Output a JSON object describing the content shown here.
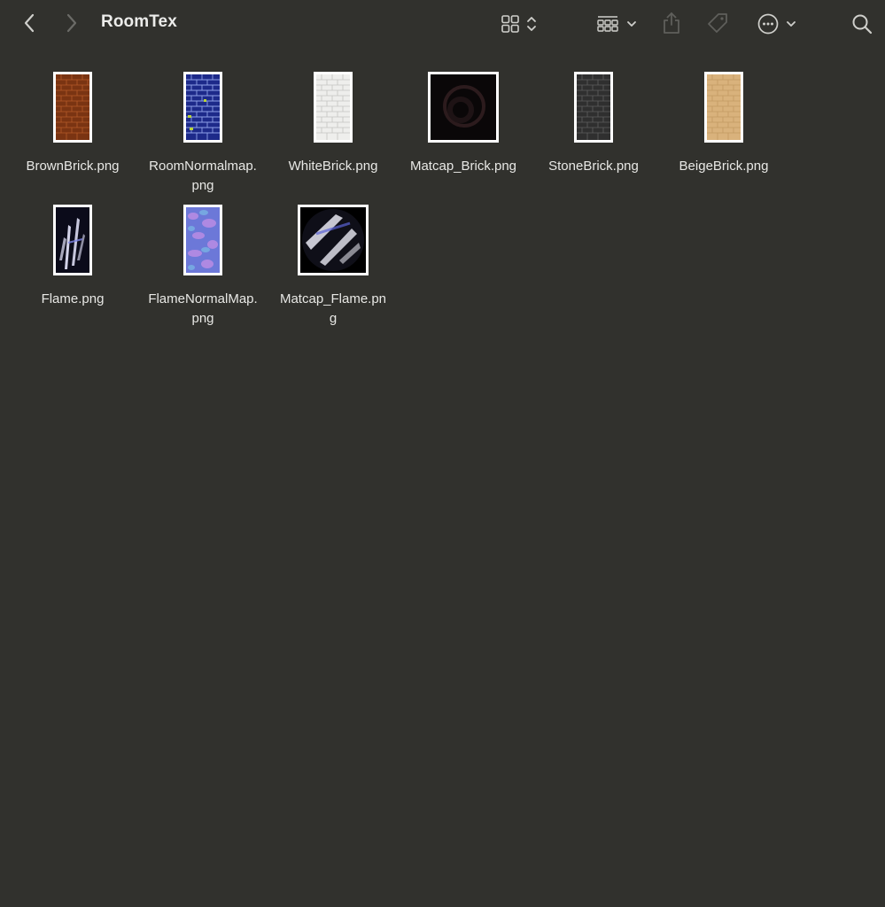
{
  "window": {
    "title": "RoomTex"
  },
  "toolbar": {
    "back": "chevron-left-icon",
    "forward": "chevron-right-icon",
    "view": "grid-view-icon",
    "group": "group-icon",
    "share": "share-icon",
    "tag": "tag-icon",
    "more": "ellipsis-circle-icon",
    "search": "search-icon"
  },
  "files": [
    {
      "line1": "BrownBrick.png",
      "line2": "",
      "colors": {
        "bg": "#7a3412",
        "line": "#b55a2a"
      }
    },
    {
      "line1": "RoomNormalmap.",
      "line2": "png",
      "colors": {
        "bg": "#1d2a8a",
        "line": "#8ea0e8"
      }
    },
    {
      "line1": "WhiteBrick.png",
      "line2": "",
      "colors": {
        "bg": "#eeeeec",
        "line": "#c4c4c1"
      }
    },
    {
      "line1": "Matcap_Brick.png",
      "line2": "",
      "colors": {
        "bg": "#0a0708",
        "line": "#3a2426"
      }
    },
    {
      "line1": "StoneBrick.png",
      "line2": "",
      "colors": {
        "bg": "#2f2f2f",
        "line": "#5e5e5e"
      }
    },
    {
      "line1": "BeigeBrick.png",
      "line2": "",
      "colors": {
        "bg": "#d9b27c",
        "line": "#c29a62"
      }
    },
    {
      "line1": "Flame.png",
      "line2": "",
      "colors": {
        "bg": "#0b0b1a",
        "line": "#e8e8ff"
      }
    },
    {
      "line1": "FlameNormalMap.",
      "line2": "png",
      "colors": {
        "bg": "#6c78d8",
        "line": "#c48fe6"
      }
    },
    {
      "line1": "Matcap_Flame.pn",
      "line2": "g",
      "colors": {
        "bg": "#000000",
        "line": "#dcdce6"
      }
    }
  ]
}
